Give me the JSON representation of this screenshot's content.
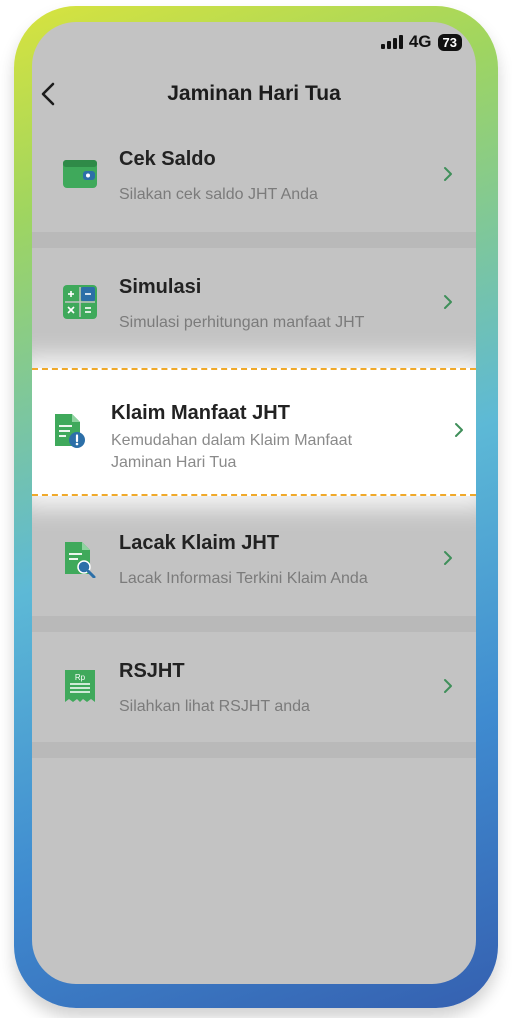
{
  "status": {
    "network": "4G",
    "battery": "73"
  },
  "header": {
    "title": "Jaminan Hari Tua"
  },
  "menu": [
    {
      "title": "Cek Saldo",
      "desc": "Silakan cek saldo JHT Anda"
    },
    {
      "title": "Simulasi",
      "desc": "Simulasi perhitungan manfaat JHT"
    },
    {
      "title": "Klaim Manfaat JHT",
      "desc": "Kemudahan dalam Klaim Manfaat Jaminan Hari Tua"
    },
    {
      "title": "Lacak Klaim JHT",
      "desc": "Lacak Informasi Terkini Klaim Anda"
    },
    {
      "title": "RSJHT",
      "desc": "Silahkan lihat RSJHT anda",
      "icon_text": "Rp"
    }
  ],
  "colors": {
    "icon_green": "#3fa95b",
    "highlight_border": "#f0a92a",
    "overlay": "#c3c3c3"
  }
}
